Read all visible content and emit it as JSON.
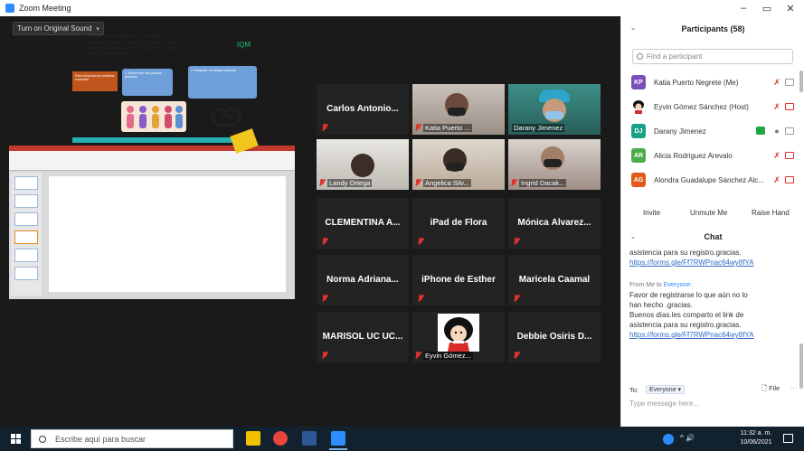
{
  "window": {
    "title": "Zoom Meeting"
  },
  "window_controls": {
    "minimize": "–",
    "restore": "▭",
    "close": "✕"
  },
  "toolbar": {
    "original_sound": "Turn on Original Sound",
    "dropdown": "▾"
  },
  "shared_slide": {
    "title": "Estrategias, actitudes, conductas y actividades para crear relaciones sanas entre mujeres y ser sororas en el ámbito laboral y personal.",
    "logo": "IQM",
    "arrow_text": "Para reconocerse positivas sororidad",
    "box1": "1. Reconocer mis propias acciones",
    "box2": "2. Respetar el trabajo realizado"
  },
  "tiles": [
    {
      "name": "Carlos Antonio...",
      "video": false
    },
    {
      "name": "Katia Puerto ...",
      "video": true
    },
    {
      "name": "Darany Jimenez",
      "video": true
    },
    {
      "name": "Landy Ortega",
      "video": true
    },
    {
      "name": "Angelica Silv...",
      "video": true
    },
    {
      "name": "Ingrid Dacak...",
      "video": true
    },
    {
      "name": "CLEMENTINA A...",
      "video": false
    },
    {
      "name": "iPad de Flora",
      "video": false
    },
    {
      "name": "Mónica Álvarez...",
      "video": false
    },
    {
      "name": "Norma Adriana...",
      "video": false
    },
    {
      "name": "iPhone de Esther",
      "video": false
    },
    {
      "name": "Maricela Caamal",
      "video": false
    },
    {
      "name": "MARISOL UC UC...",
      "video": false
    },
    {
      "name": "Eyvin Gómez...",
      "video": true
    },
    {
      "name": "Debbie Osiris D...",
      "video": false
    }
  ],
  "participants": {
    "title": "Participants (58)",
    "search_placeholder": "Find a participant",
    "list": [
      {
        "initials": "KP",
        "name": "Katia Puerto Negrete (Me)",
        "color": "#7b4fb8"
      },
      {
        "initials": "",
        "name": "Eyvin Gómez Sánchez (Host)",
        "color": "#ffffff"
      },
      {
        "initials": "DJ",
        "name": "Darany Jimenez",
        "color": "#19a087"
      },
      {
        "initials": "AR",
        "name": "Alicia Rodriguez Arevalo",
        "color": "#4cab4c"
      },
      {
        "initials": "AG",
        "name": "Alondra Guadalupe Sánchez Alc...",
        "color": "#e35b1c"
      }
    ],
    "buttons": {
      "invite": "Invite",
      "unmute": "Unmute Me",
      "raise": "Raise Hand"
    }
  },
  "chat": {
    "title": "Chat",
    "msg1": "asistencia para su registro.gracias.",
    "link1": "https://forms.gle/Ff7RWPnac64wy8fYA",
    "from_prefix": "From Me to",
    "from_to": "Everyone:",
    "msg2_l1": "Favor de registrarse lo que aún no lo",
    "msg2_l2": "han hecho .gracias.",
    "msg2_l3": "Buenos días.les comparto el link de",
    "msg2_l4": "asistencia para su registro.gracias.",
    "link2": "https://forms.gle/Ff7RWPnac64wy8fYA",
    "to_label": "To:",
    "to_value": "Everyone",
    "file_label": "File",
    "more": "···",
    "input_placeholder": "Type message here..."
  },
  "taskbar": {
    "search_placeholder": "Escribe aquí para buscar",
    "time": "11:32 a. m.",
    "date": "10/06/2021",
    "tray_icons": "^ 🔊"
  },
  "colors": {
    "accent": "#2d8cff",
    "mute_red": "#e0332c",
    "active_speaker": "#a2c83a"
  }
}
